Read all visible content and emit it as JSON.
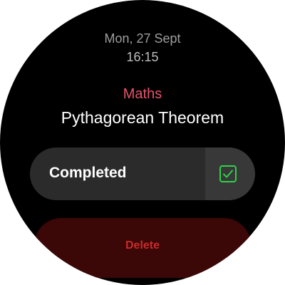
{
  "header": {
    "date": "Mon, 27 Sept",
    "time": "16:15"
  },
  "task": {
    "subject": "Maths",
    "title": "Pythagorean Theorem"
  },
  "completed": {
    "label": "Completed",
    "checked": true,
    "check_color": "#2ed14a"
  },
  "delete": {
    "label": "Delete",
    "color": "#c92a2a"
  },
  "colors": {
    "subject": "#e8546c",
    "background": "#000000"
  }
}
